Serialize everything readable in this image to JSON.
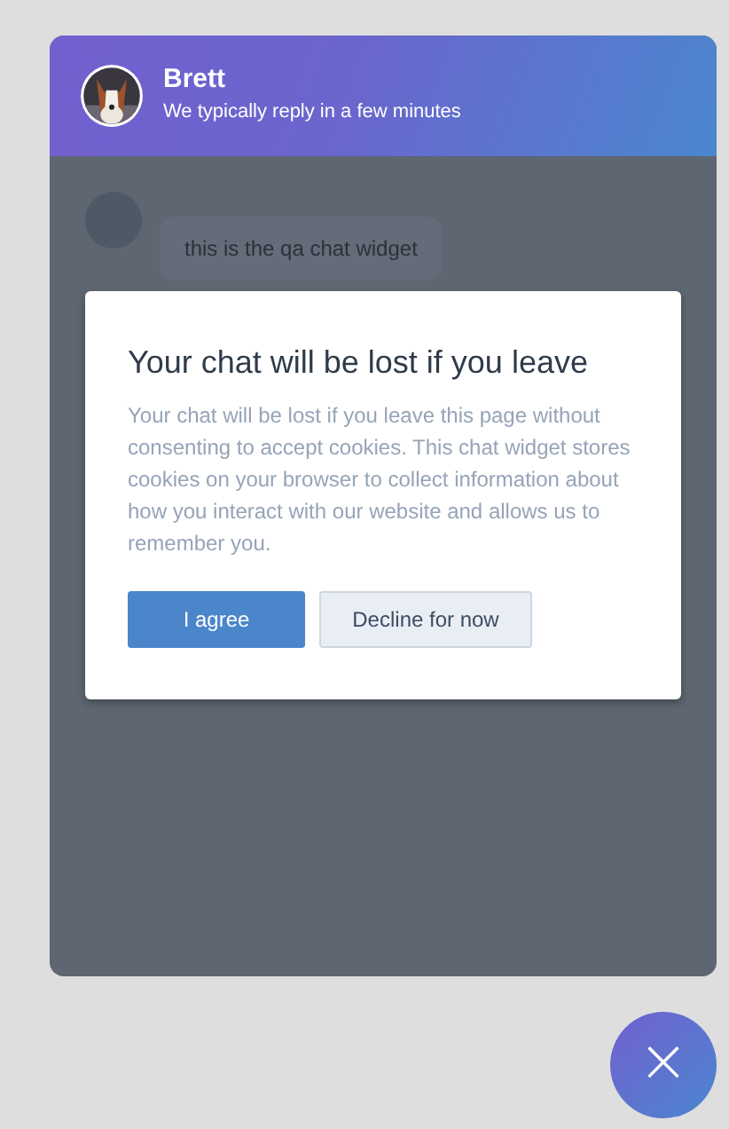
{
  "header": {
    "agent_name": "Brett",
    "status": "We typically reply in a few minutes"
  },
  "messages": [
    {
      "text": "this is the qa chat widget"
    }
  ],
  "dialog": {
    "title": "Your chat will be lost if you leave",
    "body": "Your chat will be lost if you leave this page without consenting to accept cookies. This chat widget stores cookies on your browser to collect information about how you interact with our website and allows us to remember you.",
    "buttons": [
      {
        "label": "I agree",
        "kind": "primary"
      },
      {
        "label": "Decline for now",
        "kind": "secondary"
      }
    ]
  },
  "launcher": {
    "label": "×"
  }
}
